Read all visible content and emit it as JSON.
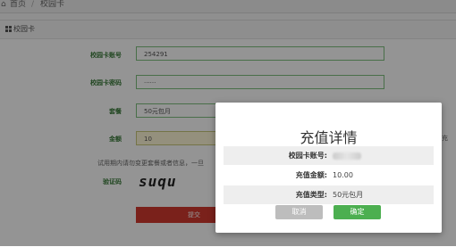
{
  "breadcrumb": {
    "home": "首页",
    "current": "校园卡"
  },
  "panel": {
    "title": "校园卡"
  },
  "form": {
    "account_label": "校园卡账号",
    "account_value": "254291",
    "password_label": "校园卡密码",
    "password_value": "······",
    "package_label": "套餐",
    "package_value": "50元包月",
    "amount_label": "金额",
    "amount_value": "10",
    "hint_text": "试用期内请勿变更套餐或者信息，一旦",
    "captcha_label": "验证码",
    "captcha_text": "suqu",
    "submit_label": "提交",
    "right_hint": "充"
  },
  "modal": {
    "title": "充值详情",
    "rows": [
      {
        "key": "校园卡账号:",
        "value": ""
      },
      {
        "key": "充值金额:",
        "value": "10.00"
      },
      {
        "key": "充值类型:",
        "value": "50元包月"
      }
    ],
    "cancel_label": "取消",
    "confirm_label": "确定"
  },
  "colors": {
    "accent_green": "#4caf50",
    "submit_red": "#d23a2f",
    "cancel_gray": "#bdbdbd"
  }
}
